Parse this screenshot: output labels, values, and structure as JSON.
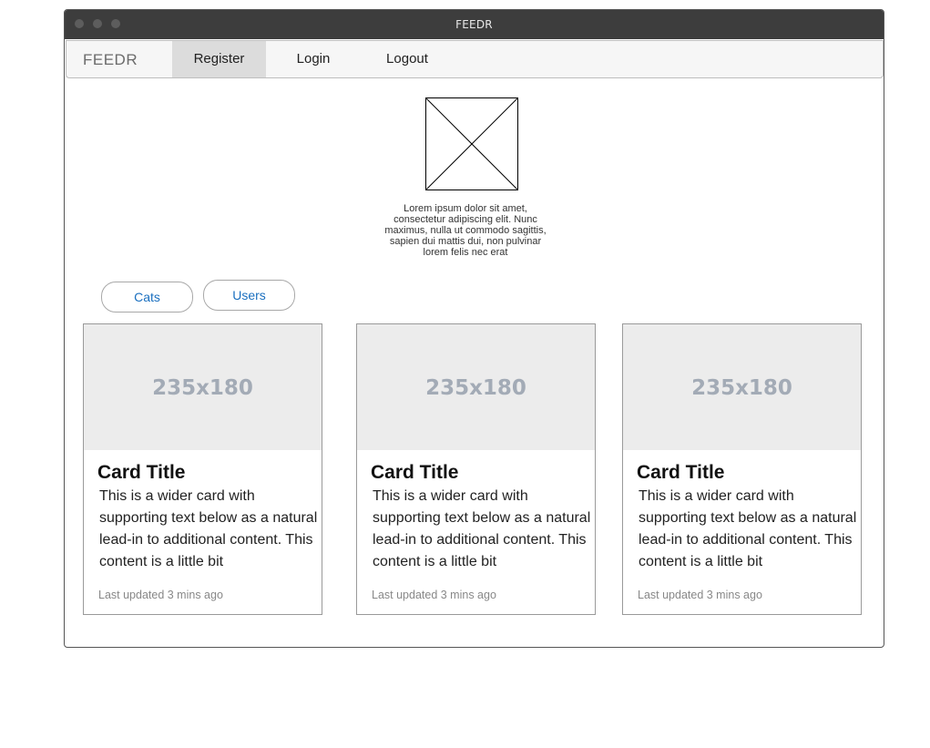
{
  "window": {
    "title": "FEEDR"
  },
  "navbar": {
    "brand": "FEEDR",
    "items": [
      {
        "label": "Register",
        "active": true
      },
      {
        "label": "Login",
        "active": false
      },
      {
        "label": "Logout",
        "active": false
      }
    ]
  },
  "intro": {
    "image_icon": "image-placeholder-icon",
    "text": "Lorem ipsum dolor sit amet, consectetur adipiscing elit. Nunc maximus, nulla ut commodo sagittis, sapien dui mattis dui, non pulvinar lorem felis nec erat"
  },
  "filters": [
    {
      "label": "Cats"
    },
    {
      "label": "Users"
    }
  ],
  "cards": [
    {
      "image_label": "235x180",
      "title": "Card Title",
      "text": "This is a wider card with supporting text below as a natural lead-in to additional content. This content is a little bit",
      "meta": "Last updated 3 mins ago"
    },
    {
      "image_label": "235x180",
      "title": "Card Title",
      "text": "This is a wider card with supporting text below as a natural lead-in to additional content. This content is a little bit",
      "meta": "Last updated 3 mins ago"
    },
    {
      "image_label": "235x180",
      "title": "Card Title",
      "text": "This is a wider card with supporting text below as a natural lead-in to additional content. This content is a little bit",
      "meta": "Last updated 3 mins ago"
    }
  ],
  "colors": {
    "titlebar": "#3d3d3d",
    "link": "#1a6fbf",
    "card_image_bg": "#ececec",
    "active_nav": "#dcdcdc"
  }
}
